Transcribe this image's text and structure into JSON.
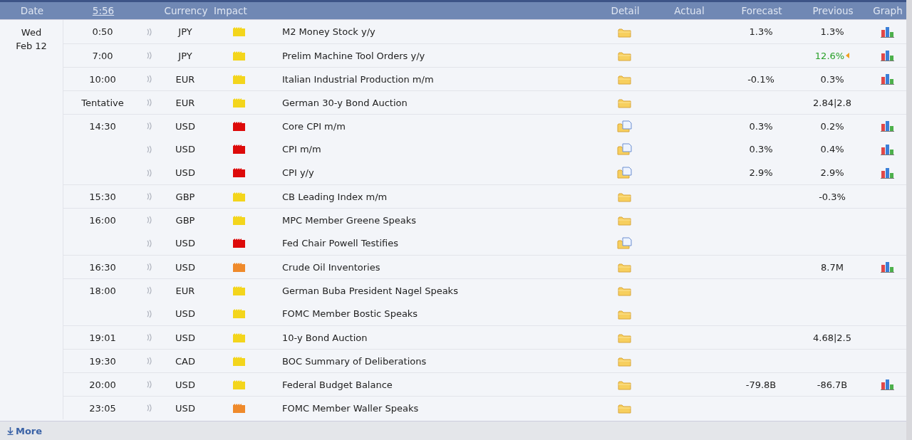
{
  "header": {
    "date": "Date",
    "clock": "5:56",
    "currency": "Currency",
    "impact": "Impact",
    "detail": "Detail",
    "actual": "Actual",
    "forecast": "Forecast",
    "previous": "Previous",
    "graph": "Graph"
  },
  "day": {
    "weekday": "Wed",
    "date": "Feb 12"
  },
  "rows": [
    {
      "time": "0:50",
      "currency": "JPY",
      "impact": {
        "color": "#f3d51c"
      },
      "event": "M2 Money Stock y/y",
      "detail": {
        "kind": "folder"
      },
      "forecast": "1.3%",
      "previous": "1.3%",
      "revised": false,
      "graph": true
    },
    {
      "time": "7:00",
      "currency": "JPY",
      "impact": {
        "color": "#f3d51c"
      },
      "event": "Prelim Machine Tool Orders y/y",
      "detail": {
        "kind": "folder"
      },
      "previous": "12.6%",
      "revised": true,
      "graph": true
    },
    {
      "time": "10:00",
      "currency": "EUR",
      "impact": {
        "color": "#f3d51c"
      },
      "event": "Italian Industrial Production m/m",
      "detail": {
        "kind": "folder"
      },
      "forecast": "-0.1%",
      "previous": "0.3%",
      "revised": false,
      "graph": true
    },
    {
      "time": "Tentative",
      "currency": "EUR",
      "impact": {
        "color": "#f3d51c"
      },
      "event": "German 30-y Bond Auction",
      "detail": {
        "kind": "folder"
      },
      "previous": "2.84|2.8",
      "revised": false,
      "graph": false
    },
    {
      "time": "14:30",
      "currency": "USD",
      "impact": {
        "color": "#dd0a0a"
      },
      "event": "Core CPI m/m",
      "detail": {
        "kind": "document"
      },
      "forecast": "0.3%",
      "previous": "0.2%",
      "revised": false,
      "graph": true
    },
    {
      "currency": "USD",
      "impact": {
        "color": "#dd0a0a"
      },
      "event": "CPI m/m",
      "detail": {
        "kind": "document"
      },
      "forecast": "0.3%",
      "previous": "0.4%",
      "revised": false,
      "graph": true
    },
    {
      "currency": "USD",
      "impact": {
        "color": "#dd0a0a"
      },
      "event": "CPI y/y",
      "detail": {
        "kind": "document"
      },
      "forecast": "2.9%",
      "previous": "2.9%",
      "revised": false,
      "graph": true
    },
    {
      "time": "15:30",
      "currency": "GBP",
      "impact": {
        "color": "#f3d51c"
      },
      "event": "CB Leading Index m/m",
      "detail": {
        "kind": "folder"
      },
      "previous": "-0.3%",
      "revised": false,
      "graph": false
    },
    {
      "time": "16:00",
      "currency": "GBP",
      "impact": {
        "color": "#f3d51c"
      },
      "event": "MPC Member Greene Speaks",
      "detail": {
        "kind": "folder"
      },
      "graph": false
    },
    {
      "currency": "USD",
      "impact": {
        "color": "#dd0a0a"
      },
      "event": "Fed Chair Powell Testifies",
      "detail": {
        "kind": "document"
      },
      "graph": false
    },
    {
      "time": "16:30",
      "currency": "USD",
      "impact": {
        "color": "#ef8a2b"
      },
      "event": "Crude Oil Inventories",
      "detail": {
        "kind": "folder"
      },
      "previous": "8.7M",
      "revised": false,
      "graph": true
    },
    {
      "time": "18:00",
      "currency": "EUR",
      "impact": {
        "color": "#f3d51c"
      },
      "event": "German Buba President Nagel Speaks",
      "detail": {
        "kind": "folder"
      },
      "graph": false
    },
    {
      "currency": "USD",
      "impact": {
        "color": "#f3d51c"
      },
      "event": "FOMC Member Bostic Speaks",
      "detail": {
        "kind": "folder"
      },
      "graph": false
    },
    {
      "time": "19:01",
      "currency": "USD",
      "impact": {
        "color": "#f3d51c"
      },
      "event": "10-y Bond Auction",
      "detail": {
        "kind": "folder"
      },
      "previous": "4.68|2.5",
      "revised": false,
      "graph": false
    },
    {
      "time": "19:30",
      "currency": "CAD",
      "impact": {
        "color": "#f3d51c"
      },
      "event": "BOC Summary of Deliberations",
      "detail": {
        "kind": "folder"
      },
      "graph": false
    },
    {
      "time": "20:00",
      "currency": "USD",
      "impact": {
        "color": "#f3d51c"
      },
      "event": "Federal Budget Balance",
      "detail": {
        "kind": "folder"
      },
      "forecast": "-79.8B",
      "previous": "-86.7B",
      "revised": false,
      "graph": true
    },
    {
      "time": "23:05",
      "currency": "USD",
      "impact": {
        "color": "#ef8a2b"
      },
      "event": "FOMC Member Waller Speaks",
      "detail": {
        "kind": "folder"
      },
      "graph": false
    }
  ],
  "more": "More"
}
